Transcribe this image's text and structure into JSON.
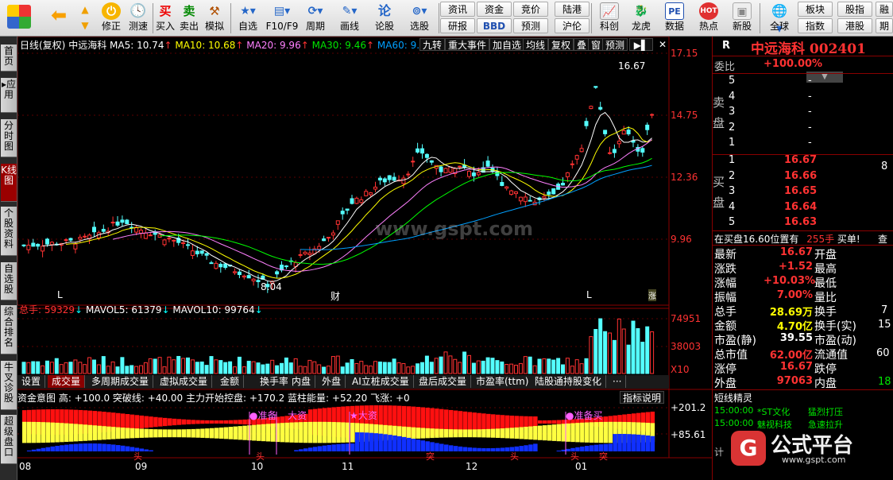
{
  "toolbar": {
    "buttons": [
      {
        "label": ""
      },
      {
        "label": ""
      },
      {
        "label": "修正"
      },
      {
        "label": "测速"
      },
      {
        "label": "买入"
      },
      {
        "label": "卖出"
      },
      {
        "label": "模拟"
      },
      {
        "label": "自选"
      },
      {
        "label": "F10/F9"
      },
      {
        "label": "周期"
      },
      {
        "label": "画线"
      },
      {
        "label": "论股"
      },
      {
        "label": "选股"
      },
      {
        "label": "科创"
      },
      {
        "label": "龙虎"
      },
      {
        "label": "数据"
      },
      {
        "label": "热点"
      },
      {
        "label": "新股"
      },
      {
        "label": "全球"
      }
    ],
    "buy_glyph": "买",
    "sell_glyph": "卖",
    "small_buttons": [
      "资讯",
      "资金",
      "竞价",
      "陆港",
      "研报",
      "BBD",
      "预测",
      "沪伦",
      "板块",
      "股指",
      "指数",
      "港股",
      "融资",
      "期货"
    ],
    "pe_glyph": "PE",
    "hot_glyph": "HOT"
  },
  "left_tabs": [
    "首页",
    "应用",
    "分时图",
    "K线图",
    "个股资料",
    "自选股",
    "综合排名",
    "牛叉诊股",
    "超级盘口"
  ],
  "chart": {
    "header": {
      "period": "日线(复权)",
      "name": "中远海科",
      "ma5": "MA5: 10.74",
      "ma10": "MA10: 10.68",
      "ma20": "MA20: 9.96",
      "ma30": "MA30: 9.46",
      "ma60": "MA60: 9.46"
    },
    "top_buttons": [
      "九转",
      "重大事件",
      "加自选",
      "均线",
      "复权",
      "叠",
      "窗",
      "预测"
    ],
    "price_labels": [
      "17.15",
      "14.75",
      "12.36",
      "9.96"
    ],
    "high_label": "16.67",
    "low_label": "8.04",
    "markers": {
      "l1": "L",
      "cai": "财",
      "l2": "L",
      "zhang": "涨"
    },
    "watermark": "www.gspt.com",
    "volume_header": {
      "total": "总手: 59329",
      "mavol5": "MAVOL5: 61379",
      "mavol10": "MAVOL10: 99764"
    },
    "volume_labels": [
      "74951",
      "38003",
      "X10"
    ],
    "volume_tabs": [
      "设置",
      "成交量",
      "多周期成交量",
      "虚拟成交量",
      "金额",
      "换手率",
      "内盘",
      "外盘",
      "AI立桩成交量",
      "盘后成交量",
      "市盈率(ttm)",
      "陆股通持股变化",
      "···"
    ],
    "indicator_header": "资金意图 高: +100.0  突破线: +40.00  主力开始控盘: +170.2  蓝柱能量: +52.20  飞涨: +0",
    "indicator_button": "指标说明",
    "indicator_labels": [
      "+201.2",
      "+85.61"
    ],
    "indicator_marks": {
      "m1": "准备",
      "m2": "大资",
      "m3": "大资",
      "m4": "准备买"
    },
    "indicator_bottom": {
      "tou1": "头",
      "tou2": "头",
      "tu": "突",
      "tou3": "头",
      "tou4": "头",
      "tu2": "突"
    },
    "date_labels": [
      "08",
      "09",
      "10",
      "11",
      "12",
      "01"
    ]
  },
  "right_panel": {
    "header_r": "R",
    "stock_name": "中远海科",
    "stock_code": "002401",
    "weibi_label": "委比",
    "weibi_value": "+100.00%",
    "sell_label": "卖盘",
    "sell_rows": [
      {
        "n": "5",
        "p": "-"
      },
      {
        "n": "4",
        "p": "-"
      },
      {
        "n": "3",
        "p": "-"
      },
      {
        "n": "2",
        "p": "-"
      },
      {
        "n": "1",
        "p": "-"
      }
    ],
    "buy_label": "买盘",
    "buy_rows": [
      {
        "n": "1",
        "p": "16.67"
      },
      {
        "n": "2",
        "p": "16.66"
      },
      {
        "n": "3",
        "p": "16.65"
      },
      {
        "n": "4",
        "p": "16.64"
      },
      {
        "n": "5",
        "p": "16.63"
      }
    ],
    "status_line": {
      "text": "在买盘16.60位置有",
      "qty": "255手",
      "action": "买单!",
      "query": "查"
    },
    "quote": [
      {
        "l": "最新",
        "v": "16.67",
        "l2": "开盘"
      },
      {
        "l": "涨跌",
        "v": "+1.52",
        "l2": "最高"
      },
      {
        "l": "涨幅",
        "v": "+10.03%",
        "l2": "最低"
      },
      {
        "l": "振幅",
        "v": "7.00%",
        "l2": "量比"
      },
      {
        "l": "总手",
        "v": "28.69万",
        "l2": "换手"
      },
      {
        "l": "金额",
        "v": "4.70亿",
        "l2": "换手(实)"
      },
      {
        "l": "市盈(静)",
        "v": "39.55",
        "l2": "市盈(动)"
      },
      {
        "l": "总市值",
        "v": "62.00亿",
        "l2": "流通值"
      },
      {
        "l": "涨停",
        "v": "16.67",
        "l2": "跌停"
      },
      {
        "l": "外盘",
        "v": "97063",
        "l2": "内盘"
      }
    ],
    "partial": {
      "r7": "7",
      "r15": "15",
      "r60": "60",
      "r18": "18",
      "r8": "8"
    },
    "short_title": "短线精灵",
    "short_rows": [
      {
        "time": "15:00:00",
        "name": "*ST文化",
        "event": "猛烈打压"
      },
      {
        "time": "15:00:00",
        "name": "魅视科技",
        "event": "急速拉升"
      }
    ],
    "bottom_label": "计"
  },
  "watermark_logo": {
    "text": "公式平台",
    "url": "www.gspt.com"
  },
  "colors": {
    "accent_red": "#ff3232",
    "up_red": "#ff3232",
    "down_cyan": "#54ffff",
    "ma5": "#ffffff",
    "ma10": "#ffff00",
    "ma20": "#ff80ff",
    "ma30": "#00ff00",
    "ma60": "#00a0ff"
  }
}
